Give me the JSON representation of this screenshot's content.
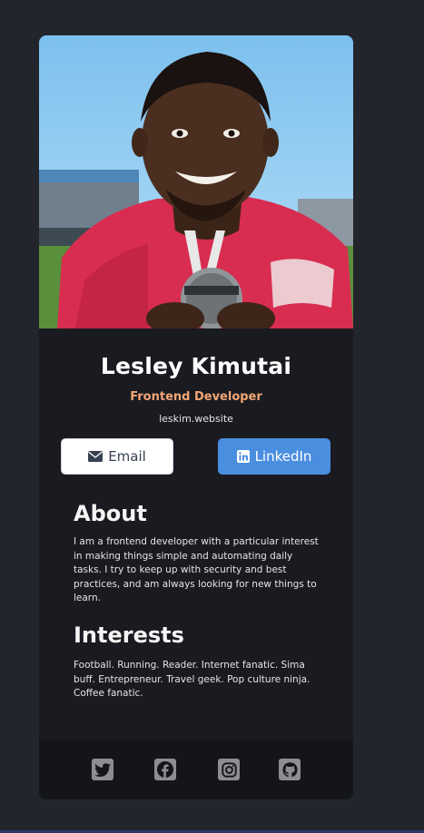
{
  "profile": {
    "name": "Lesley Kimutai",
    "role": "Frontend Developer",
    "website": "leskim.website",
    "photo_icon": "profile-photo"
  },
  "actions": {
    "email_label": "Email",
    "email_icon": "envelope-icon",
    "linkedin_label": "LinkedIn",
    "linkedin_icon": "linkedin-icon"
  },
  "about": {
    "title": "About",
    "text": "I am a frontend developer with a particular interest in making things simple and automating daily tasks. I try to keep up with security and best practices, and am always looking for new things to learn."
  },
  "interests": {
    "title": "Interests",
    "text": "Football. Running. Reader. Internet fanatic. Sima buff. Entrepreneur. Travel geek. Pop culture ninja. Coffee fanatic."
  },
  "footer": {
    "icons": [
      "twitter-icon",
      "facebook-icon",
      "instagram-icon",
      "github-icon"
    ]
  },
  "colors": {
    "background": "#23252c",
    "card": "#1a1b20",
    "footer": "#141519",
    "accent_role": "#f3a676",
    "linkedin_button": "#4a8ee0",
    "icon_gray": "#8d8d92"
  }
}
